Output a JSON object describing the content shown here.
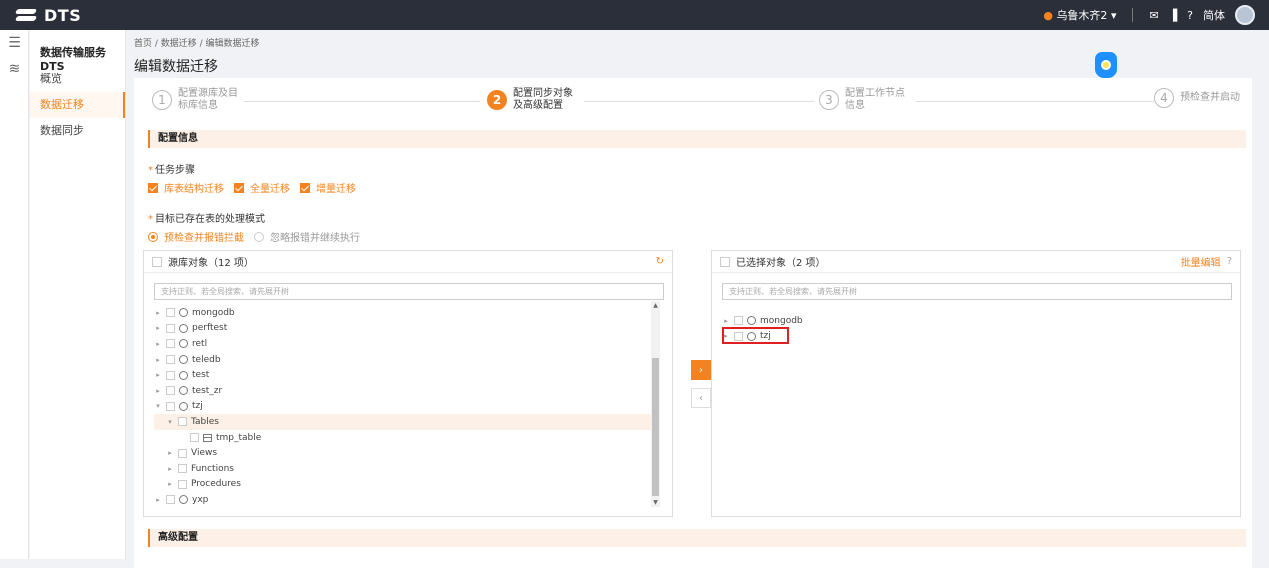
{
  "topbar": {
    "logo": "DTS",
    "region": "乌鲁木齐2",
    "region_caret": "▾",
    "mail_icon": "✉",
    "chart_icon": "▐",
    "help_icon": "?",
    "language": "简体"
  },
  "sidebar": {
    "title": "数据传输服务DTS",
    "items": [
      {
        "label": "概览"
      },
      {
        "label": "数据迁移"
      },
      {
        "label": "数据同步"
      }
    ]
  },
  "breadcrumb": "首页 / 数据迁移 / 编辑数据迁移",
  "page_title": "编辑数据迁移",
  "steps": [
    {
      "num": "1",
      "line1": "配置源库及目",
      "line2": "标库信息"
    },
    {
      "num": "2",
      "line1": "配置同步对象",
      "line2": "及高级配置"
    },
    {
      "num": "3",
      "line1": "配置工作节点",
      "line2": "信息"
    },
    {
      "num": "4",
      "line1": "预检查并启动",
      "line2": ""
    }
  ],
  "config_section": "配置信息",
  "task_steps": {
    "label": "任务步骤",
    "options": [
      "库表结构迁移",
      "全量迁移",
      "增量迁移"
    ]
  },
  "existing_table_mode": {
    "label": "目标已存在表的处理模式",
    "options": [
      "预检查并报错拦截",
      "忽略报错并继续执行"
    ]
  },
  "source_panel": {
    "title": "源库对象（12 项）",
    "refresh_icon": "↻",
    "search_placeholder": "支持正则、若全局搜索、请先展开树",
    "tree": [
      {
        "label": "mongodb",
        "type": "db",
        "depth": 0,
        "caret": "▸"
      },
      {
        "label": "perftest",
        "type": "db",
        "depth": 0,
        "caret": "▸"
      },
      {
        "label": "retl",
        "type": "db",
        "depth": 0,
        "caret": "▸"
      },
      {
        "label": "teledb",
        "type": "db",
        "depth": 0,
        "caret": "▸"
      },
      {
        "label": "test",
        "type": "db",
        "depth": 0,
        "caret": "▸"
      },
      {
        "label": "test_zr",
        "type": "db",
        "depth": 0,
        "caret": "▸"
      },
      {
        "label": "tzj",
        "type": "db",
        "depth": 0,
        "caret": "▾"
      },
      {
        "label": "Tables",
        "type": "folder",
        "depth": 1,
        "caret": "▾"
      },
      {
        "label": "tmp_table",
        "type": "table",
        "depth": 2,
        "caret": ""
      },
      {
        "label": "Views",
        "type": "folder",
        "depth": 1,
        "caret": "▸"
      },
      {
        "label": "Functions",
        "type": "folder",
        "depth": 1,
        "caret": "▸"
      },
      {
        "label": "Procedures",
        "type": "folder",
        "depth": 1,
        "caret": "▸"
      },
      {
        "label": "yxp",
        "type": "db",
        "depth": 0,
        "caret": "▸"
      }
    ]
  },
  "target_panel": {
    "title": "已选择对象（2 项）",
    "batch_edit": "批量编辑",
    "help_icon": "?",
    "search_placeholder": "支持正则、若全局搜索、请先展开树",
    "tree": [
      {
        "label": "mongodb",
        "type": "db",
        "depth": 0,
        "caret": "▸"
      },
      {
        "label": "tzj",
        "type": "db",
        "depth": 0,
        "caret": "▸"
      }
    ]
  },
  "transfer": {
    "right": "›",
    "left": "‹"
  },
  "advanced_section": "高级配置"
}
